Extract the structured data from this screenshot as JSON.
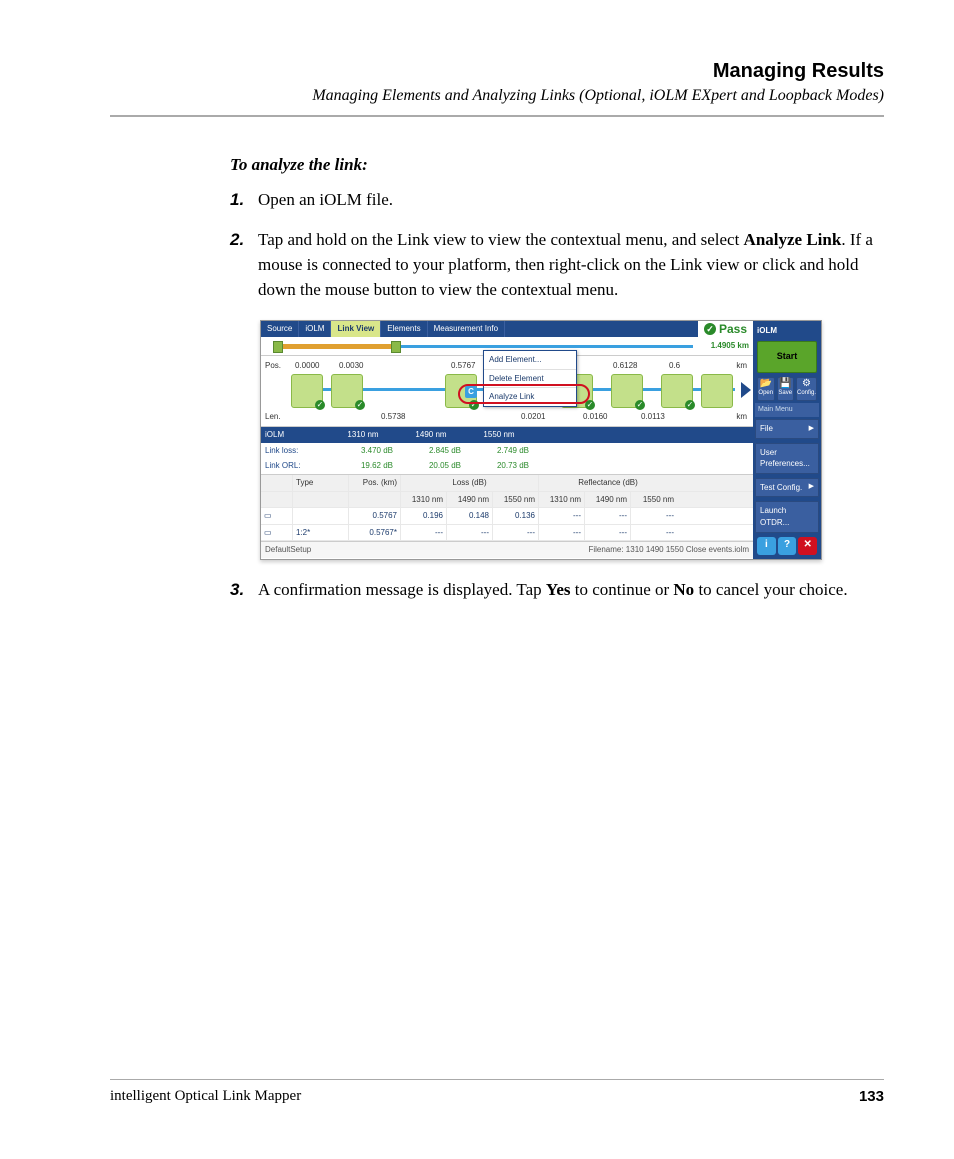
{
  "header": {
    "title": "Managing Results",
    "subtitle": "Managing Elements and Analyzing Links (Optional, iOLM EXpert and Loopback Modes)"
  },
  "section_heading": "To analyze the link:",
  "steps": {
    "s1": {
      "num": "1.",
      "text": "Open an iOLM file."
    },
    "s2": {
      "num": "2.",
      "pre": "Tap and hold on the Link view to view the contextual menu, and select ",
      "bold": "Analyze Link",
      "post": ". If a mouse is connected to your platform, then right-click on the Link view or click and hold down the mouse button to view the contextual menu."
    },
    "s3": {
      "num": "3.",
      "pre": "A confirmation message is displayed. Tap ",
      "b1": "Yes",
      "mid": " to continue or ",
      "b2": "No",
      "post": " to cancel your choice."
    }
  },
  "shot": {
    "tabs": {
      "source": "Source",
      "iolm": "iOLM",
      "linkview": "Link View",
      "elements": "Elements",
      "meas": "Measurement Info"
    },
    "pass": "Pass",
    "total_km": "1.4905 km",
    "pos_label": "Pos.",
    "len_label": "Len.",
    "km_unit": "km",
    "pos": {
      "p0": "0.0000",
      "p1": "0.0030",
      "p2": "0.5767",
      "p3": "0.5",
      "p4": "0.6128",
      "p5": "0.6"
    },
    "len": {
      "l0": "0.5738",
      "l1": "0.0201",
      "l2": "0.0160",
      "l3": "0.0113"
    },
    "ctx": {
      "add": "Add Element...",
      "del": "Delete Element",
      "ana": "Analyze Link"
    },
    "c_badge": "C",
    "res": {
      "hdr_iolm": "iOLM",
      "w1": "1310 nm",
      "w2": "1490 nm",
      "w3": "1550 nm",
      "row1_lbl": "Link loss:",
      "r1v1": "3.470 dB",
      "r1v2": "2.845 dB",
      "r1v3": "2.749 dB",
      "row2_lbl": "Link ORL:",
      "r2v1": "19.62 dB",
      "r2v2": "20.05 dB",
      "r2v3": "20.73 dB"
    },
    "grid": {
      "h_type": "Type",
      "h_pos": "Pos. (km)",
      "h_loss": "Loss (dB)",
      "h_refl": "Reflectance (dB)",
      "w1": "1310 nm",
      "w2": "1490 nm",
      "w3": "1550 nm",
      "r1_type": "",
      "r1_pos": "0.5767",
      "r1_l1": "0.196",
      "r1_l2": "0.148",
      "r1_l3": "0.136",
      "r1_r1": "---",
      "r1_r2": "---",
      "r1_r3": "---",
      "r2_type": "1:2*",
      "r2_pos": "0.5767*",
      "r2_l1": "---",
      "r2_l2": "---",
      "r2_l3": "---",
      "r2_r1": "---",
      "r2_r2": "---",
      "r2_r3": "---"
    },
    "foot": {
      "left": "DefaultSetup",
      "right": "Filename: 1310 1490 1550 Close events.iolm"
    },
    "side": {
      "title": "iOLM",
      "start": "Start",
      "open": "Open",
      "save": "Save",
      "config": "Config.",
      "mainmenu": "Main Menu",
      "file": "File",
      "userpref": "User Preferences...",
      "testcfg": "Test Config.",
      "launch": "Launch OTDR..."
    }
  },
  "footer": {
    "left": "intelligent Optical Link Mapper",
    "right": "133"
  }
}
